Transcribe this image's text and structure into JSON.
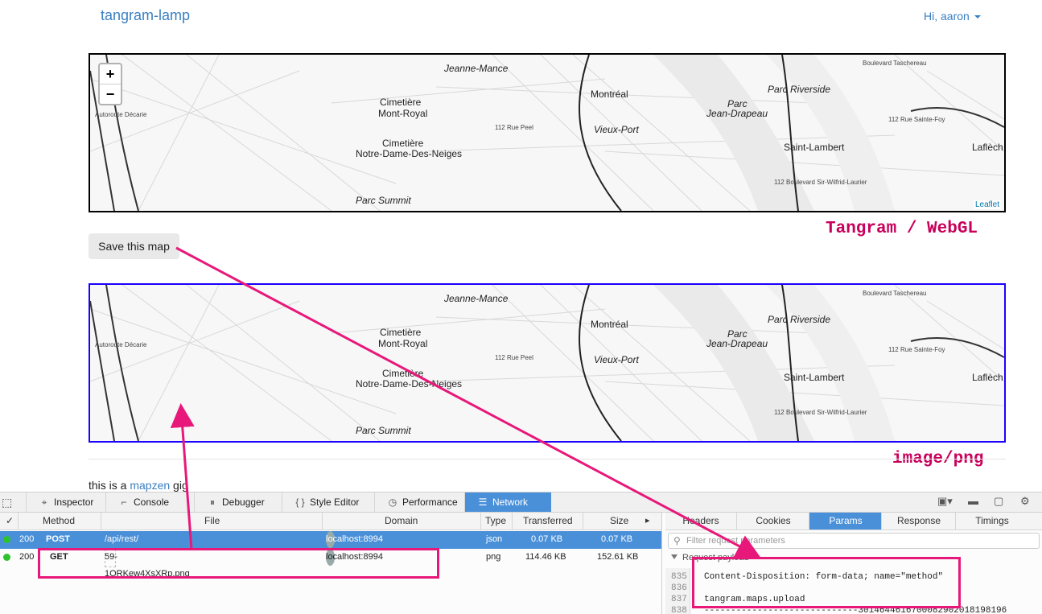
{
  "header": {
    "brand": "tangram-lamp",
    "user_menu": "Hi, aaron"
  },
  "map": {
    "labels": [
      "Jeanne-Mance",
      "Cimetière",
      "Mont-Royal",
      "Cimetière",
      "Notre-Dame-Des-Neiges",
      "Parc Summit",
      "Montréal",
      "Vieux-Port",
      "Parc",
      "Jean-Drapeau",
      "Parc Riverside",
      "Saint-Lambert",
      "Laflèch",
      "112 Rue Peel",
      "112 Boulevard Sir-Wilfrid-Laurier",
      "112 Rue Sainte-Foy",
      "Autoroute Décarie",
      "Boulevard Taschereau"
    ],
    "zoom_in": "+",
    "zoom_out": "−",
    "attribution": "Leaflet"
  },
  "captions": {
    "webgl": "Tangram / WebGL",
    "png": "image/png"
  },
  "save_button": "Save this map",
  "body_text": {
    "prefix": "this is a ",
    "link": "mapzen",
    "suffix": " gig"
  },
  "devtools": {
    "tools": [
      {
        "label": "Inspector",
        "icon": "inspector-icon"
      },
      {
        "label": "Console",
        "icon": "console-icon"
      },
      {
        "label": "Debugger",
        "icon": "debugger-icon"
      },
      {
        "label": "Style Editor",
        "icon": "style-editor-icon"
      },
      {
        "label": "Performance",
        "icon": "performance-icon"
      },
      {
        "label": "Network",
        "icon": "network-icon"
      }
    ],
    "columns": {
      "check": "✓",
      "method": "Method",
      "file": "File",
      "domain": "Domain",
      "type": "Type",
      "transferred": "Transferred",
      "size": "Size"
    },
    "requests": [
      {
        "status": "200",
        "method": "POST",
        "file": "/api/rest/",
        "domain": "localhost:8994",
        "type": "json",
        "transferred": "0.07 KB",
        "size": "0.07 KB"
      },
      {
        "status": "200",
        "method": "GET",
        "file": "59-1ORKew4XsXRp.png",
        "domain": "localhost:8994",
        "type": "png",
        "transferred": "114.46 KB",
        "size": "152.61 KB"
      }
    ],
    "detail_tabs": [
      "Headers",
      "Cookies",
      "Params",
      "Response",
      "Timings"
    ],
    "filter_placeholder": "Filter request parameters",
    "payload_header": "Request payload",
    "code_lines": [
      {
        "num": "835",
        "text": "Content-Disposition: form-data; name=\"method\""
      },
      {
        "num": "836",
        "text": ""
      },
      {
        "num": "837",
        "text": "tangram.maps.upload"
      },
      {
        "num": "838",
        "text": "-----------------------------3014644616700082902018198196"
      }
    ]
  },
  "colors": {
    "accent": "#3a7fc1",
    "annotation": "#e8187a",
    "caption": "#c8005a",
    "network_selected": "#4a90d9"
  }
}
